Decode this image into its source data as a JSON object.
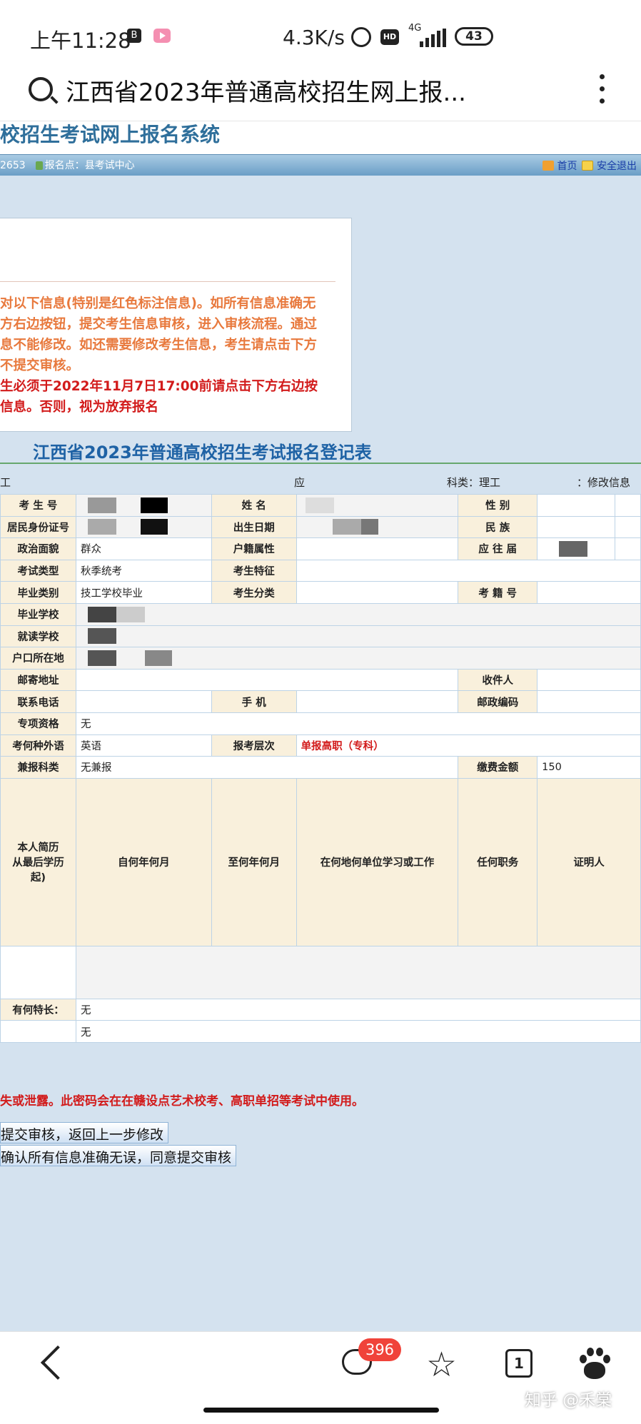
{
  "status_bar": {
    "time": "上午11:28",
    "net_speed": "4.3K/s",
    "net_type": "4G",
    "battery": "43"
  },
  "browser": {
    "search_text": "江西省2023年普通高校招生网上报..."
  },
  "site": {
    "title": "校招生考试网上报名系统",
    "nav_left": "2653",
    "nav_location": "报名点：县考试中心",
    "nav_home": "首页",
    "nav_logout": "安全退出"
  },
  "notice": {
    "lines": [
      "对以下信息(特别是红色标注信息)。如所有信息准确无",
      "方右边按钮，提交考生信息审核，进入审核流程。通过",
      "息不能修改。如还需要修改考生信息，考生请点击下方",
      "不提交审核。"
    ],
    "red_lines": [
      "生必须于2022年11月7日17:00前请点击下方右边按",
      "信息。否则，视为放弃报名"
    ]
  },
  "form": {
    "title": "江西省2023年普通高校招生考试报名登记表",
    "row0_left": "工",
    "row0_mid": "应",
    "row0_category": "科类：理工",
    "row0_right": "：修改信息",
    "labels": {
      "exam_no": "考 生 号",
      "name": "姓  名",
      "gender": "性  别",
      "id_no": "居民身份证号",
      "birth": "出生日期",
      "ethnicity": "民  族",
      "politics": "政治面貌",
      "hukou_type": "户籍属性",
      "fresh": "应 往 届",
      "exam_type": "考试类型",
      "trait": "考生特征",
      "grad_type": "毕业类别",
      "student_cat": "考生分类",
      "student_no": "考 籍 号",
      "grad_school": "毕业学校",
      "current_school": "就读学校",
      "hukou_place": "户口所在地",
      "mail_addr": "邮寄地址",
      "receiver": "收件人",
      "phone": "联系电话",
      "mobile": "手  机",
      "postcode": "邮政编码",
      "special": "专项资格",
      "foreign_lang": "考何种外语",
      "level": "报考层次",
      "concurrent": "兼报科类",
      "fee": "缴费金额",
      "resume": "本人简历",
      "resume_sub": "从最后学历起)",
      "from": "自何年何月",
      "to": "至何年何月",
      "where": "在何地何单位学习或工作",
      "post": "任何职务",
      "witness": "证明人",
      "specialty": "有何特长："
    },
    "values": {
      "politics": "群众",
      "exam_type": "秋季统考",
      "grad_type": "技工学校毕业",
      "special": "无",
      "foreign_lang": "英语",
      "level": "单报高职（专科）",
      "concurrent": "无兼报",
      "fee": "150",
      "specialty": "无",
      "last": "无"
    }
  },
  "warning": "失或泄露。此密码会在在赣设点艺术校考、高职单招等考试中使用。",
  "buttons": {
    "back": "提交审核，返回上一步修改",
    "submit": "确认所有信息准确无误，同意提交审核"
  },
  "bottom_nav": {
    "comment_count": "396",
    "tab_count": "1",
    "watermark": "知乎 @禾棠"
  }
}
